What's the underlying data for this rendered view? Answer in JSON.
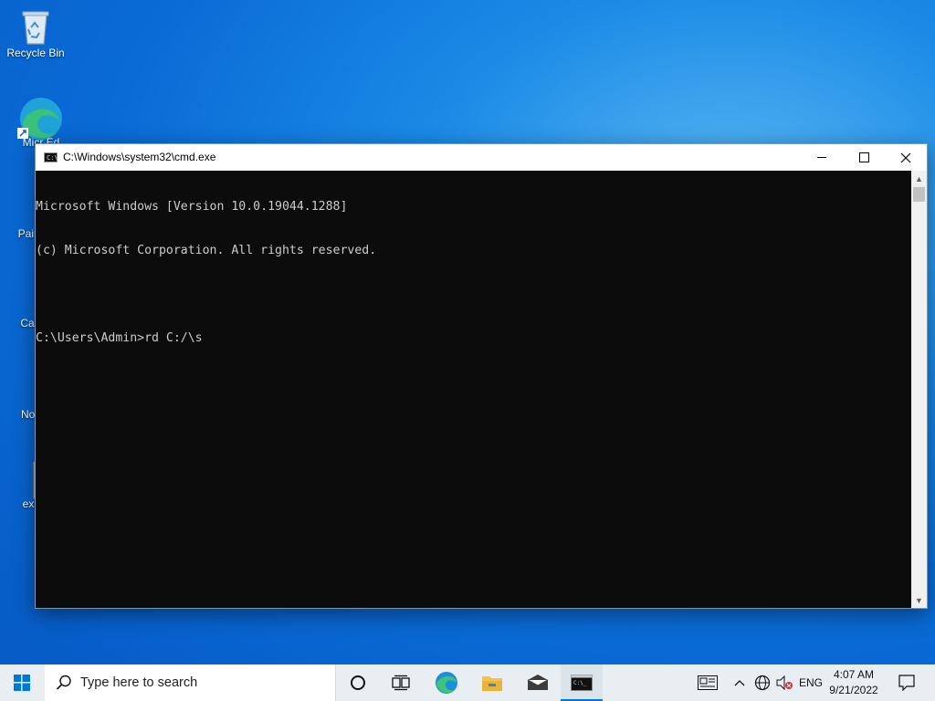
{
  "desktop": {
    "icons": [
      {
        "name": "recycle-bin",
        "label": "Recycle Bin"
      },
      {
        "name": "microsoft-edge",
        "label": "Micr Ed"
      },
      {
        "name": "paint-x",
        "label": "Paint X"
      },
      {
        "name": "calculator",
        "label": "Calcul"
      },
      {
        "name": "notepad",
        "label": "Notep"
      },
      {
        "name": "explorer",
        "label": "explo"
      }
    ]
  },
  "window": {
    "title": "C:\\Windows\\system32\\cmd.exe",
    "icon": "cmd-icon",
    "console_lines": [
      "Microsoft Windows [Version 10.0.19044.1288]",
      "(c) Microsoft Corporation. All rights reserved.",
      "",
      "C:\\Users\\Admin>rd C:/\\s"
    ]
  },
  "taskbar": {
    "search_placeholder": "Type here to search",
    "pinned": [
      "cortana-icon",
      "task-view-icon",
      "edge-icon",
      "file-explorer-icon",
      "mail-icon",
      "cmd-taskbar-icon"
    ],
    "tray": {
      "language": "ENG",
      "time": "4:07 AM",
      "date": "9/21/2022"
    }
  },
  "colors": {
    "accent": "#0078d7",
    "console_bg": "#0c0c0c",
    "console_fg": "#cccccc"
  }
}
